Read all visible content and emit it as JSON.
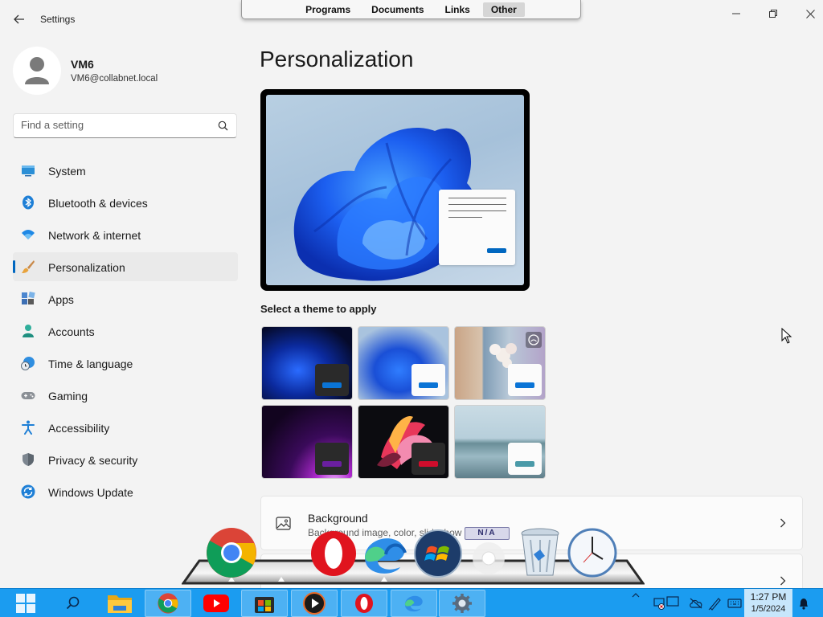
{
  "window": {
    "app_title": "Settings"
  },
  "toolbar": {
    "tabs": [
      {
        "label": "Programs",
        "active": false
      },
      {
        "label": "Documents",
        "active": false
      },
      {
        "label": "Links",
        "active": false
      },
      {
        "label": "Other",
        "active": true
      }
    ]
  },
  "user": {
    "name": "VM6",
    "email": "VM6@collabnet.local"
  },
  "search": {
    "placeholder": "Find a setting"
  },
  "sidebar": {
    "items": [
      {
        "label": "System",
        "icon": "monitor-icon"
      },
      {
        "label": "Bluetooth & devices",
        "icon": "bluetooth-icon"
      },
      {
        "label": "Network & internet",
        "icon": "wifi-icon"
      },
      {
        "label": "Personalization",
        "icon": "paintbrush-icon",
        "active": true
      },
      {
        "label": "Apps",
        "icon": "apps-icon"
      },
      {
        "label": "Accounts",
        "icon": "person-icon"
      },
      {
        "label": "Time & language",
        "icon": "globe-clock-icon"
      },
      {
        "label": "Gaming",
        "icon": "gamepad-icon"
      },
      {
        "label": "Accessibility",
        "icon": "accessibility-icon"
      },
      {
        "label": "Privacy & security",
        "icon": "shield-icon"
      },
      {
        "label": "Windows Update",
        "icon": "update-icon"
      }
    ]
  },
  "main": {
    "title": "Personalization",
    "themes_label": "Select a theme to apply",
    "cards": [
      {
        "title": "Background",
        "subtitle": "Background image, color, slideshow",
        "icon": "image-icon"
      },
      {
        "title": "",
        "subtitle": "",
        "icon": ""
      }
    ]
  },
  "taskbar": {
    "time": "1:27 PM",
    "date": "1/5/2024",
    "dock_badge": "N/A"
  },
  "colors": {
    "accent": "#0067c0",
    "taskbar": "#1b9cf0"
  }
}
